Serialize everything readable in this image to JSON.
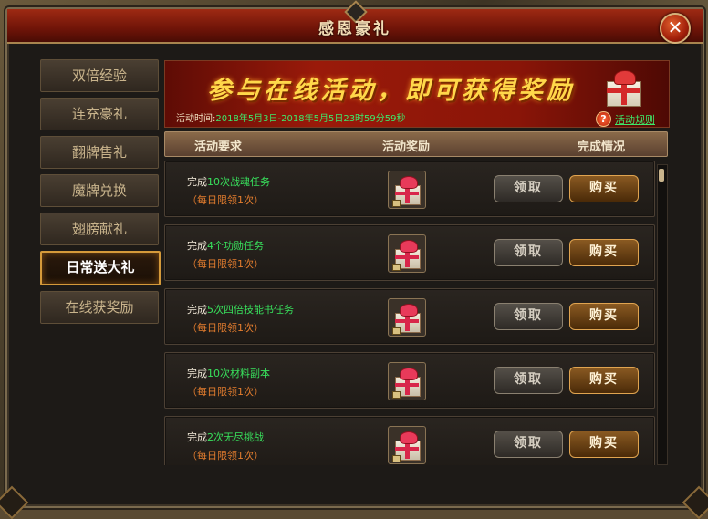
{
  "window": {
    "title": "感恩豪礼"
  },
  "sidebar": {
    "items": [
      {
        "label": "双倍经验",
        "active": false
      },
      {
        "label": "连充豪礼",
        "active": false
      },
      {
        "label": "翻牌售礼",
        "active": false
      },
      {
        "label": "魔牌兑换",
        "active": false
      },
      {
        "label": "翅膀献礼",
        "active": false
      },
      {
        "label": "日常送大礼",
        "active": true
      },
      {
        "label": "在线获奖励",
        "active": false
      }
    ]
  },
  "banner": {
    "headline": "参与在线活动，即可获得奖励",
    "time_label": "活动时间:",
    "time_value": "2018年5月3日-2018年5月5日23时59分59秒",
    "rules_link": "活动规则"
  },
  "table": {
    "headers": [
      "活动要求",
      "活动奖励",
      "完成情况"
    ],
    "rows": [
      {
        "prefix": "完成",
        "highlight": "10次战魂任务",
        "limit": "（每日限领1次）",
        "claim": "领取",
        "buy": "购买"
      },
      {
        "prefix": "完成",
        "highlight": "4个功勋任务",
        "limit": "（每日限领1次）",
        "claim": "领取",
        "buy": "购买"
      },
      {
        "prefix": "完成",
        "highlight": "5次四倍技能书任务",
        "limit": "（每日限领1次）",
        "claim": "领取",
        "buy": "购买"
      },
      {
        "prefix": "完成",
        "highlight": "10次材料副本",
        "limit": "（每日限领1次）",
        "claim": "领取",
        "buy": "购买"
      },
      {
        "prefix": "完成",
        "highlight": "2次无尽挑战",
        "limit": "（每日限领1次）",
        "claim": "领取",
        "buy": "购买"
      }
    ]
  },
  "icons": {
    "close": "close-icon",
    "help": "help-icon",
    "reward": "gift-box-icon"
  }
}
